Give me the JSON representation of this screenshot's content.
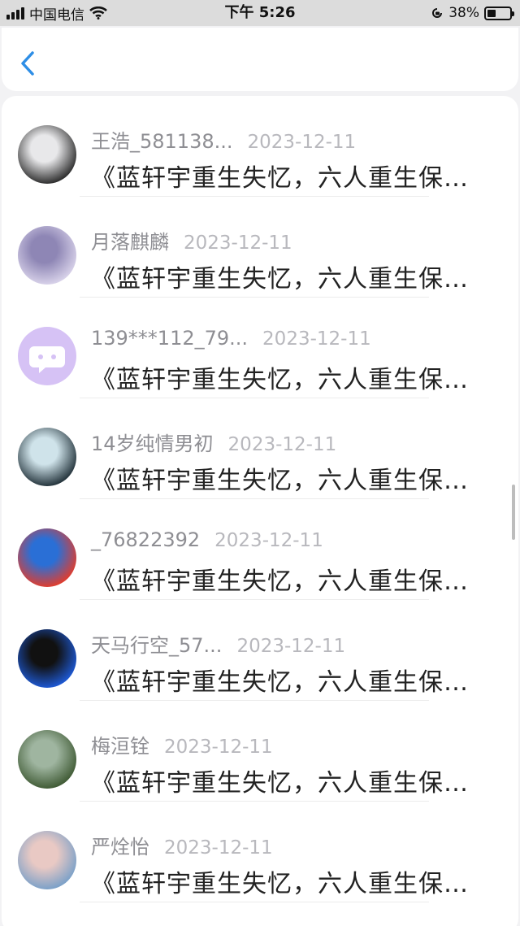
{
  "status_bar": {
    "carrier": "中国电信",
    "time": "下午 5:26",
    "battery": "38%",
    "battery_level": 0.38
  },
  "nav": {
    "back_icon": "chevron-left-icon"
  },
  "comments": [
    {
      "username": "王浩_581138...",
      "date": "2023-12-11",
      "text": "《蓝轩宇重生失忆，六人重生保…",
      "avatar_colors": [
        "#2b2b2b",
        "#e8e8ea"
      ]
    },
    {
      "username": "月落麒麟",
      "date": "2023-12-11",
      "text": "《蓝轩宇重生失忆，六人重生保…",
      "avatar_colors": [
        "#d9d3ea",
        "#8e86b5"
      ]
    },
    {
      "username": "139***112_79...",
      "date": "2023-12-11",
      "text": "《蓝轩宇重生失忆，六人重生保…",
      "avatar_colors": [
        "#d6c2f5",
        "#ffffff"
      ]
    },
    {
      "username": "14岁纯情男初",
      "date": "2023-12-11",
      "text": "《蓝轩宇重生失忆，六人重生保…",
      "avatar_colors": [
        "#22323a",
        "#cfe3ea"
      ]
    },
    {
      "username": "_76822392",
      "date": "2023-12-11",
      "text": "《蓝轩宇重生失忆，六人重生保…",
      "avatar_colors": [
        "#e23c2c",
        "#2a6fd6"
      ]
    },
    {
      "username": "天马行空_57...",
      "date": "2023-12-11",
      "text": "《蓝轩宇重生失忆，六人重生保…",
      "avatar_colors": [
        "#1e5ad6",
        "#111111"
      ]
    },
    {
      "username": "梅洹铨",
      "date": "2023-12-11",
      "text": "《蓝轩宇重生失忆，六人重生保…",
      "avatar_colors": [
        "#3f5a34",
        "#9fb5a0"
      ]
    },
    {
      "username": "严烇怡",
      "date": "2023-12-11",
      "text": "《蓝轩宇重生失忆，六人重生保…",
      "avatar_colors": [
        "#7aa0c8",
        "#e9c9c4"
      ]
    }
  ]
}
